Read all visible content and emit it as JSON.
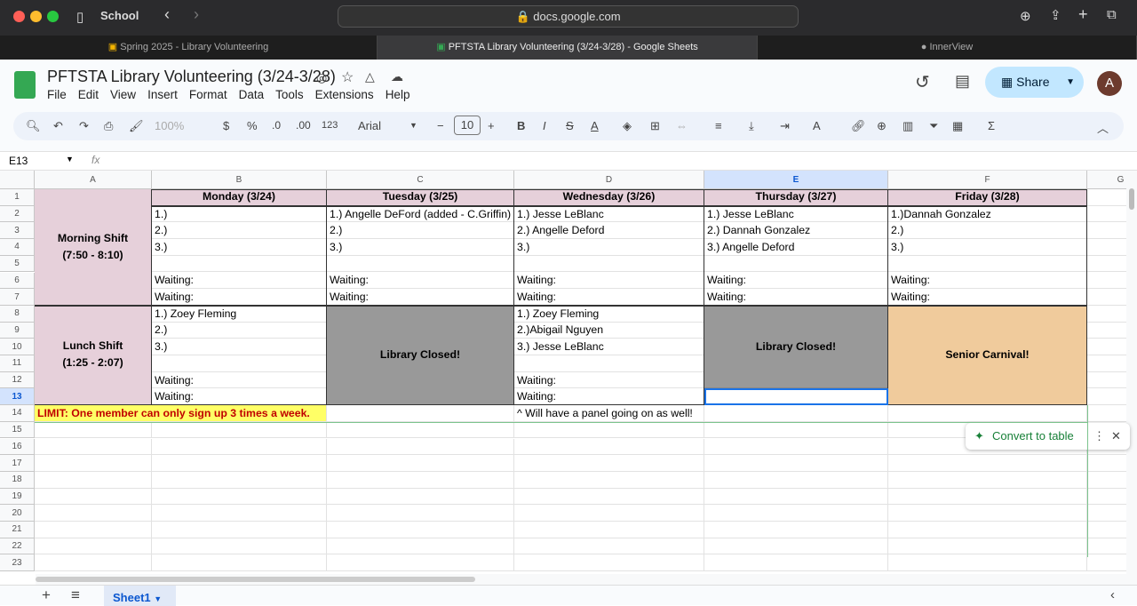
{
  "browser": {
    "profile": "School",
    "url": "docs.google.com"
  },
  "tabs": [
    {
      "label": "Spring 2025 - Library Volunteering"
    },
    {
      "label": "PFTSTA Library Volunteering (3/24-3/28) - Google Sheets"
    },
    {
      "label": "InnerView"
    }
  ],
  "doc": {
    "title": "PFTSTA Library Volunteering (3/24-3/28)",
    "menu": [
      "File",
      "Edit",
      "View",
      "Insert",
      "Format",
      "Data",
      "Tools",
      "Extensions",
      "Help"
    ],
    "share": "Share",
    "avatar": "A"
  },
  "toolbar": {
    "zoom": "100%",
    "currency": "$",
    "percent": "%",
    "dec_dec": ".0",
    "inc_dec": ".00",
    "format_123": "123",
    "font": "Arial",
    "font_size": "10",
    "bold": "B",
    "italic": "I"
  },
  "formula_bar": {
    "cell_ref": "E13",
    "fx": "fx",
    "value": ""
  },
  "columns": [
    "A",
    "B",
    "C",
    "D",
    "E",
    "F",
    "G"
  ],
  "rows": [
    "1",
    "2",
    "3",
    "4",
    "5",
    "6",
    "7",
    "8",
    "9",
    "10",
    "11",
    "12",
    "13",
    "14",
    "15",
    "16",
    "17",
    "18",
    "19",
    "20",
    "21",
    "22",
    "23"
  ],
  "colors": {
    "pink": "#e6d0da",
    "gray": "#999999",
    "orange": "#f0cb9c",
    "yellow": "#ffff66",
    "limit_text": "#c00000",
    "selection": "#1a73e8"
  },
  "cells": [
    {
      "r": 0,
      "c": 0,
      "rs": 7,
      "text": "Morning Shift\n(7:50 - 8:10)",
      "bg": "pink",
      "bold": true,
      "center": true
    },
    {
      "r": 0,
      "c": 1,
      "text": "Monday (3/24)",
      "bg": "pink",
      "bold": true,
      "center": true
    },
    {
      "r": 0,
      "c": 2,
      "text": "Tuesday (3/25)",
      "bg": "pink",
      "bold": true,
      "center": true
    },
    {
      "r": 0,
      "c": 3,
      "text": "Wednesday (3/26)",
      "bg": "pink",
      "bold": true,
      "center": true
    },
    {
      "r": 0,
      "c": 4,
      "text": "Thursday (3/27)",
      "bg": "pink",
      "bold": true,
      "center": true
    },
    {
      "r": 0,
      "c": 5,
      "text": "Friday (3/28)",
      "bg": "pink",
      "bold": true,
      "center": true
    },
    {
      "r": 1,
      "c": 1,
      "text": "1.)"
    },
    {
      "r": 1,
      "c": 2,
      "text": "1.) Angelle DeFord (added - C.Griffin)"
    },
    {
      "r": 1,
      "c": 3,
      "text": "1.) Jesse LeBlanc"
    },
    {
      "r": 1,
      "c": 4,
      "text": "1.) Jesse LeBlanc"
    },
    {
      "r": 1,
      "c": 5,
      "text": "1.)Dannah Gonzalez"
    },
    {
      "r": 2,
      "c": 1,
      "text": "2.)"
    },
    {
      "r": 2,
      "c": 2,
      "text": "2.)"
    },
    {
      "r": 2,
      "c": 3,
      "text": "2.) Angelle Deford"
    },
    {
      "r": 2,
      "c": 4,
      "text": "2.) Dannah Gonzalez"
    },
    {
      "r": 2,
      "c": 5,
      "text": "2.)"
    },
    {
      "r": 3,
      "c": 1,
      "text": "3.)"
    },
    {
      "r": 3,
      "c": 2,
      "text": "3.)"
    },
    {
      "r": 3,
      "c": 3,
      "text": "3.)"
    },
    {
      "r": 3,
      "c": 4,
      "text": "3.) Angelle Deford"
    },
    {
      "r": 3,
      "c": 5,
      "text": "3.)"
    },
    {
      "r": 5,
      "c": 1,
      "text": "Waiting:"
    },
    {
      "r": 5,
      "c": 2,
      "text": "Waiting:"
    },
    {
      "r": 5,
      "c": 3,
      "text": "Waiting:"
    },
    {
      "r": 5,
      "c": 4,
      "text": "Waiting:"
    },
    {
      "r": 5,
      "c": 5,
      "text": "Waiting:"
    },
    {
      "r": 6,
      "c": 1,
      "text": "Waiting:"
    },
    {
      "r": 6,
      "c": 2,
      "text": "Waiting:"
    },
    {
      "r": 6,
      "c": 3,
      "text": "Waiting:"
    },
    {
      "r": 6,
      "c": 4,
      "text": "Waiting:"
    },
    {
      "r": 6,
      "c": 5,
      "text": "Waiting:"
    },
    {
      "r": 7,
      "c": 0,
      "rs": 6,
      "text": "Lunch Shift\n(1:25 - 2:07)",
      "bg": "pink",
      "bold": true,
      "center": true
    },
    {
      "r": 7,
      "c": 1,
      "text": "1.) Zoey Fleming"
    },
    {
      "r": 7,
      "c": 2,
      "rs": 6,
      "text": "Library Closed!",
      "bg": "gray",
      "bold": true,
      "center": true
    },
    {
      "r": 7,
      "c": 3,
      "text": "1.) Zoey Fleming"
    },
    {
      "r": 7,
      "c": 4,
      "rs": 5,
      "text": "Library Closed!",
      "bg": "gray",
      "bold": true,
      "center": true
    },
    {
      "r": 7,
      "c": 5,
      "rs": 6,
      "text": "Senior Carnival!",
      "bg": "orange",
      "bold": true,
      "center": true
    },
    {
      "r": 8,
      "c": 1,
      "text": "2.)"
    },
    {
      "r": 8,
      "c": 3,
      "text": "2.)Abigail Nguyen"
    },
    {
      "r": 9,
      "c": 1,
      "text": "3.)"
    },
    {
      "r": 9,
      "c": 3,
      "text": "3.) Jesse LeBlanc"
    },
    {
      "r": 11,
      "c": 1,
      "text": "Waiting:"
    },
    {
      "r": 11,
      "c": 3,
      "text": "Waiting:"
    },
    {
      "r": 12,
      "c": 1,
      "text": "Waiting:"
    },
    {
      "r": 12,
      "c": 3,
      "text": "Waiting:"
    },
    {
      "r": 12,
      "c": 4,
      "text": "",
      "selected": true
    },
    {
      "r": 13,
      "c": 0,
      "cs": 2,
      "text": "LIMIT: One member can only sign up 3 times a week.",
      "bg": "yellow",
      "bold": true,
      "color": "limit_text"
    },
    {
      "r": 13,
      "c": 3,
      "text": "^ Will have a panel going on as well!"
    }
  ],
  "popup": {
    "label": "Convert to table"
  },
  "sheet_tabs": [
    {
      "label": "Sheet1"
    }
  ]
}
